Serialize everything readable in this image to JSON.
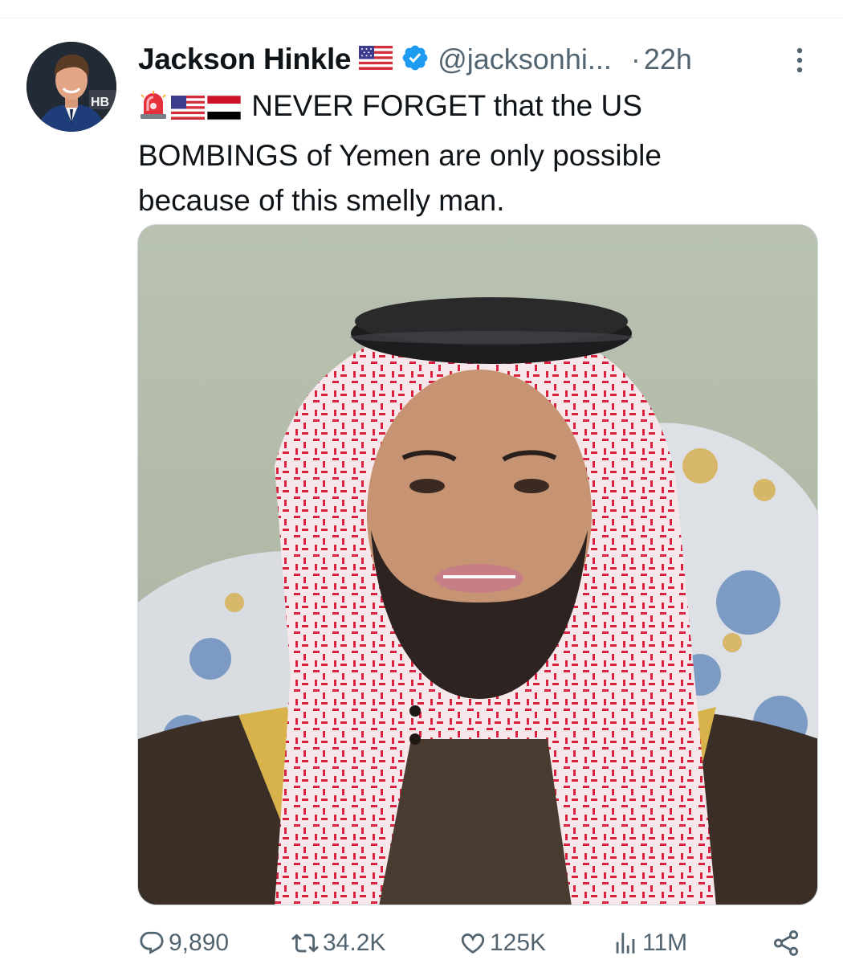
{
  "author": {
    "name": "Jackson Hinkle",
    "handle": "@jacksonhi...",
    "timestamp": "22h",
    "separator": "·"
  },
  "tweet": {
    "text_line1": "NEVER FORGET that the US",
    "text_line2": "BOMBINGS of Yemen are only possible",
    "text_line3": "because of this smelly man.",
    "emojis": [
      "rotating-light-icon",
      "flag-us-icon",
      "flag-yemen-icon"
    ]
  },
  "stats": {
    "replies": "9,890",
    "reposts": "34.2K",
    "likes": "125K",
    "views": "11M"
  },
  "colors": {
    "text_primary": "#0f1419",
    "text_secondary": "#536471",
    "verified_blue": "#1d9bf0",
    "divider": "#eff3f4"
  },
  "icons": {
    "verified": "verified-badge-icon",
    "more": "more-vertical-icon",
    "reply": "reply-icon",
    "repost": "repost-icon",
    "like": "heart-icon",
    "views": "views-chart-icon",
    "share": "share-icon"
  }
}
